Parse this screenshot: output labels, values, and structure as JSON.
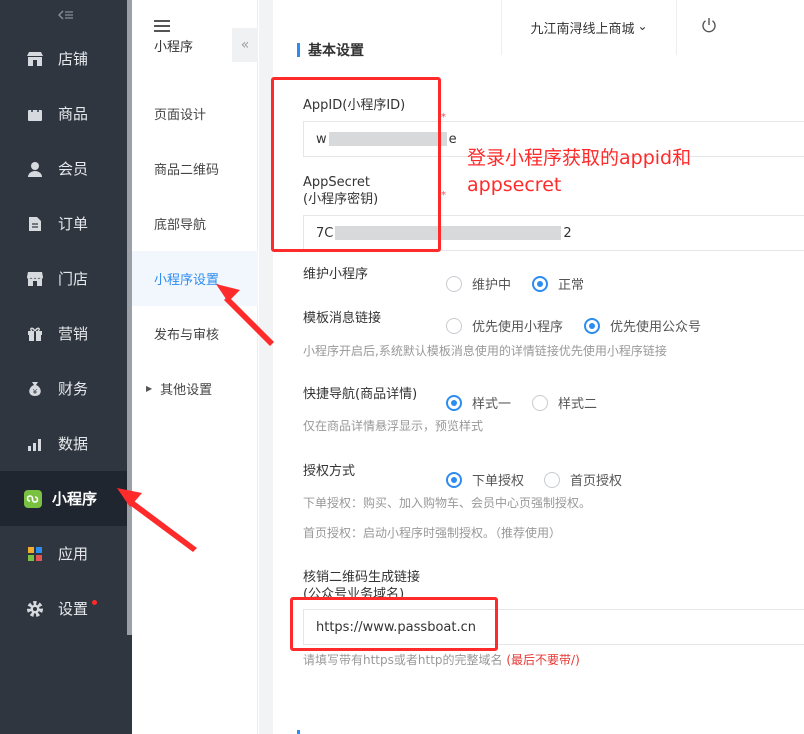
{
  "sidebar": {
    "collapse_icon": "collapse-icon",
    "items": [
      {
        "label": "店铺",
        "icon": "store-icon"
      },
      {
        "label": "商品",
        "icon": "bag-icon"
      },
      {
        "label": "会员",
        "icon": "user-icon"
      },
      {
        "label": "订单",
        "icon": "document-icon"
      },
      {
        "label": "门店",
        "icon": "shop-icon"
      },
      {
        "label": "营销",
        "icon": "gift-icon"
      },
      {
        "label": "财务",
        "icon": "money-bag-icon"
      },
      {
        "label": "数据",
        "icon": "bar-chart-icon"
      },
      {
        "label": "小程序",
        "icon": "miniprogram-icon",
        "active": true
      },
      {
        "label": "应用",
        "icon": "apps-icon"
      },
      {
        "label": "设置",
        "icon": "gear-icon",
        "badge_dot": true
      }
    ]
  },
  "submenu": {
    "title": "小程序",
    "fold_icon": "«",
    "items": [
      {
        "label": "页面设计"
      },
      {
        "label": "商品二维码"
      },
      {
        "label": "底部导航"
      },
      {
        "label": "小程序设置",
        "active": true
      },
      {
        "label": "发布与审核"
      },
      {
        "label": "其他设置",
        "expandable": true
      }
    ]
  },
  "topbar": {
    "store_name": "九江南浔线上商城",
    "store_chevron": "⌄",
    "power_icon": "power-icon"
  },
  "main": {
    "section_title": "基本设置",
    "appid": {
      "label": "AppID(小程序ID)",
      "value_start": "w",
      "value_end": "e",
      "required_mark": "*"
    },
    "appsecret": {
      "label_line1": "AppSecret",
      "label_line2": "(小程序密钥)",
      "value_start": "7C",
      "value_end": "2",
      "required_mark": "*"
    },
    "maintain": {
      "label": "维护小程序",
      "options": [
        "维护中",
        "正常"
      ],
      "selected": "正常"
    },
    "template_link": {
      "label": "模板消息链接",
      "options": [
        "优先使用小程序",
        "优先使用公众号"
      ],
      "selected": "优先使用公众号",
      "hint": "小程序开启后,系统默认模板消息使用的详情链接优先使用小程序链接"
    },
    "quick_nav": {
      "label": "快捷导航(商品详情)",
      "options": [
        "样式一",
        "样式二"
      ],
      "selected": "样式一",
      "hint": "仅在商品详情悬浮显示，预览样式"
    },
    "auth": {
      "label": "授权方式",
      "options": [
        "下单授权",
        "首页授权"
      ],
      "selected": "下单授权",
      "hint1": "下单授权：购买、加入购物车、会员中心页强制授权。",
      "hint2": "首页授权：启动小程序时强制授权。（推荐使用）"
    },
    "verify_link": {
      "label_line1": "核销二维码生成链接",
      "label_line2": "(公众号业务域名)",
      "value": "https://www.passboat.cn",
      "hint": "请填写带有https或者http的完整域名",
      "hint_red": "(最后不要带/)"
    }
  },
  "annotation": {
    "text_line1": "登录小程序获取的appid和",
    "text_line2": "appsecret",
    "color": "#ff2a2a"
  }
}
